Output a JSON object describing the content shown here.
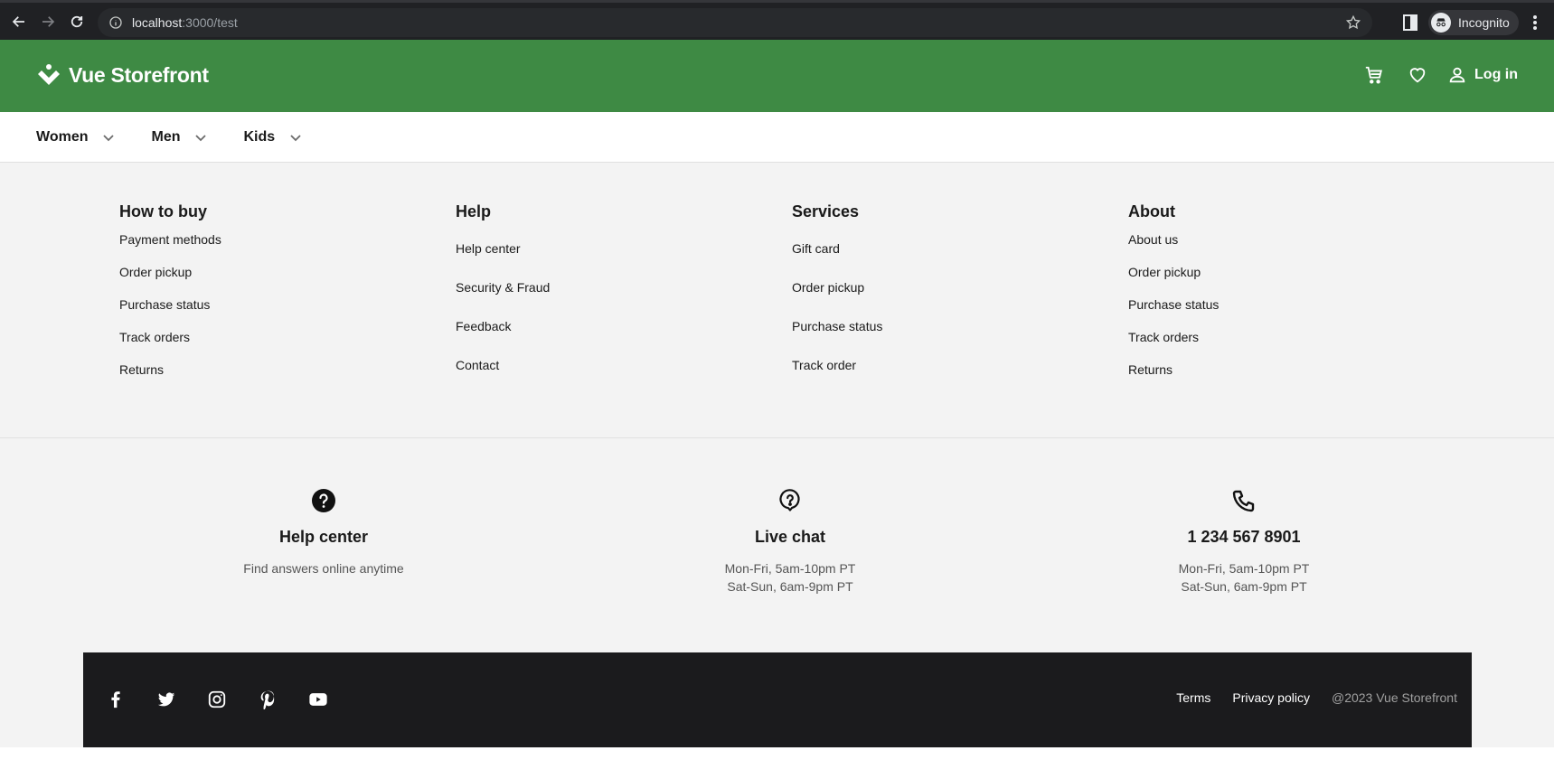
{
  "browser": {
    "url_host": "localhost",
    "url_rest": ":3000/test",
    "profile_label": "Incognito"
  },
  "header": {
    "brand": "Vue Storefront",
    "login_label": "Log in",
    "brand_color": "#3e8a44"
  },
  "categories": [
    {
      "label": "Women"
    },
    {
      "label": "Men"
    },
    {
      "label": "Kids"
    }
  ],
  "footer": {
    "columns": [
      {
        "title": "How to buy",
        "links": [
          "Payment methods",
          "Order pickup",
          "Purchase status",
          "Track orders",
          "Returns"
        ]
      },
      {
        "title": "Help",
        "links": [
          "Help center",
          "Security & Fraud",
          "Feedback",
          "Contact"
        ]
      },
      {
        "title": "Services",
        "links": [
          "Gift card",
          "Order pickup",
          "Purchase status",
          "Track order"
        ]
      },
      {
        "title": "About",
        "links": [
          "About us",
          "Order pickup",
          "Purchase status",
          "Track orders",
          "Returns"
        ]
      }
    ],
    "contacts": [
      {
        "icon": "help-circle-icon",
        "title": "Help center",
        "lines": [
          "Find answers online anytime"
        ]
      },
      {
        "icon": "live-chat-icon",
        "title": "Live chat",
        "lines": [
          "Mon-Fri, 5am-10pm PT",
          "Sat-Sun, 6am-9pm PT"
        ]
      },
      {
        "icon": "phone-icon",
        "title": "1 234 567 8901",
        "lines": [
          "Mon-Fri, 5am-10pm PT",
          "Sat-Sun, 6am-9pm PT"
        ]
      }
    ],
    "socials": [
      "facebook-icon",
      "twitter-icon",
      "instagram-icon",
      "pinterest-icon",
      "youtube-icon"
    ],
    "legal": {
      "terms": "Terms",
      "privacy": "Privacy policy",
      "copyright": "@2023 Vue Storefront"
    }
  }
}
